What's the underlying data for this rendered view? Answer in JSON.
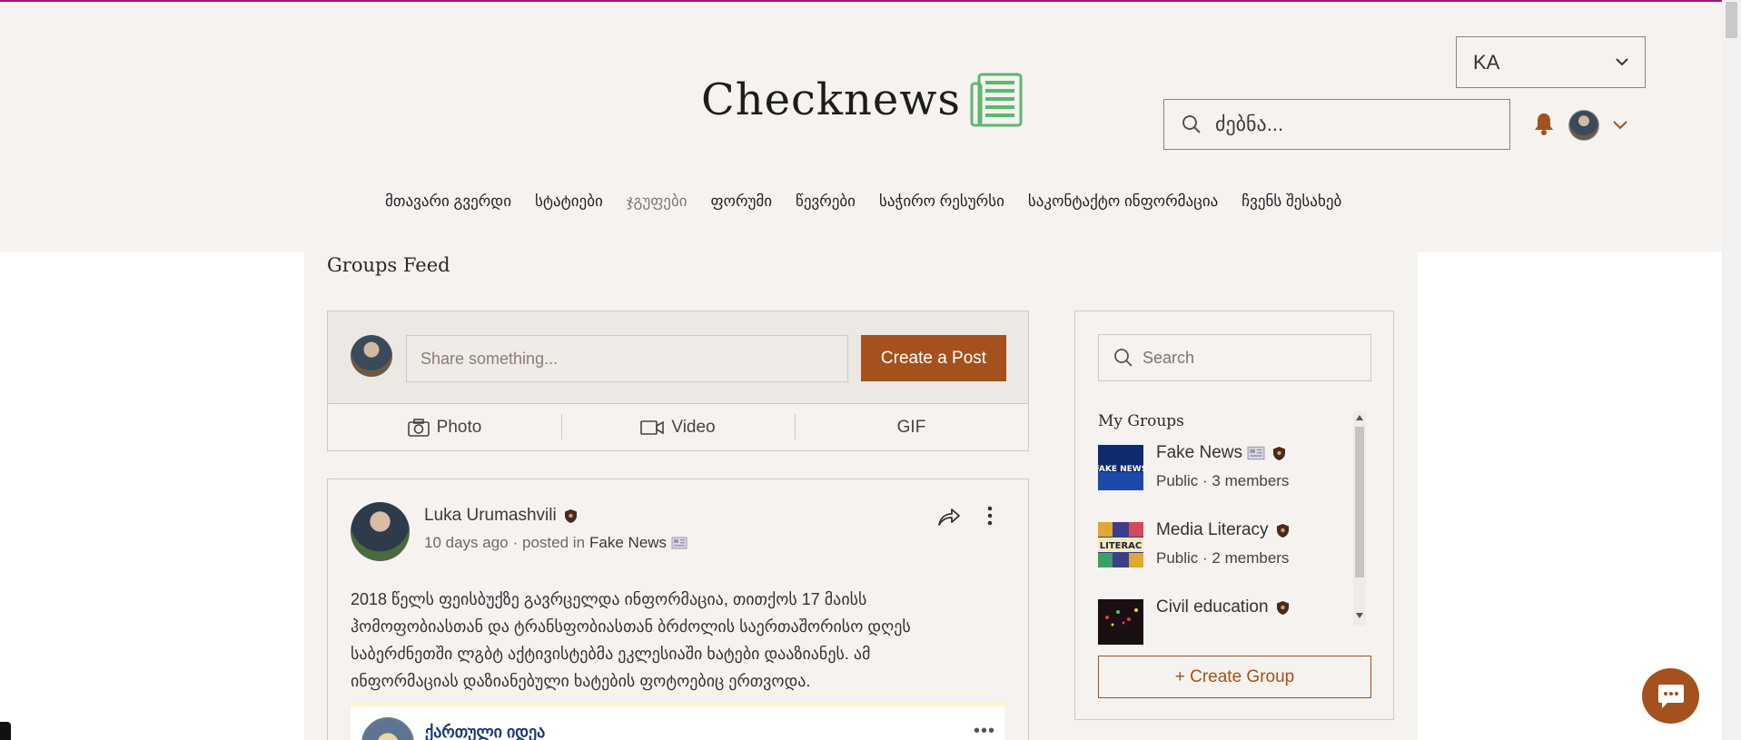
{
  "header": {
    "logo_text": "Checknews",
    "language": "KA",
    "search_placeholder": "ძებნა...",
    "nav": [
      {
        "label": "მთავარი გვერდი"
      },
      {
        "label": "სტატიები"
      },
      {
        "label": "ჯგუფები"
      },
      {
        "label": "ფორუმი"
      },
      {
        "label": "წევრები"
      },
      {
        "label": "საჭირო რესურსი"
      },
      {
        "label": "საკონტაქტო ინფორმაცია"
      },
      {
        "label": "ჩვენს შესახებ"
      }
    ]
  },
  "feed": {
    "title": "Groups Feed",
    "composer": {
      "placeholder": "Share something...",
      "create_post_label": "Create a Post",
      "photo_label": "Photo",
      "video_label": "Video",
      "gif_label": "GIF"
    },
    "post": {
      "author": "Luka Urumashvili",
      "time": "10 days ago",
      "posted_in_prefix": "· posted in",
      "group": "Fake News",
      "text": "2018 წელს ფეისბუქზე გავრცელდა ინფორმაცია, თითქოს 17 მაისს ჰომოფობიასთან და ტრანსფობიასთან ბრძოლის საერთაშორისო დღეს საბერძნეთში ლგბტ აქტივისტებმა ეკლესიაში ხატები დააზიანეს. ამ ინფორმაციას დაზიანებული ხატების ფოტოებიც ერთვოდა.",
      "embed_title": "ქართული იდეა",
      "embed_more": "•••"
    }
  },
  "sidebar": {
    "search_placeholder": "Search",
    "my_groups_title": "My Groups",
    "groups": [
      {
        "name": "Fake News",
        "meta": "Public · 3 members",
        "thumb_text": "FAKE NEWS"
      },
      {
        "name": "Media Literacy",
        "meta": "Public · 2 members",
        "thumb_text": "LITERAC"
      },
      {
        "name": "Civil education",
        "meta": ""
      }
    ],
    "create_group_label": "+ Create Group"
  },
  "colors": {
    "accent": "#a4511d",
    "background": "#f5f2ef",
    "top_line": "#a0157f",
    "logo_icon": "#5cb870"
  }
}
